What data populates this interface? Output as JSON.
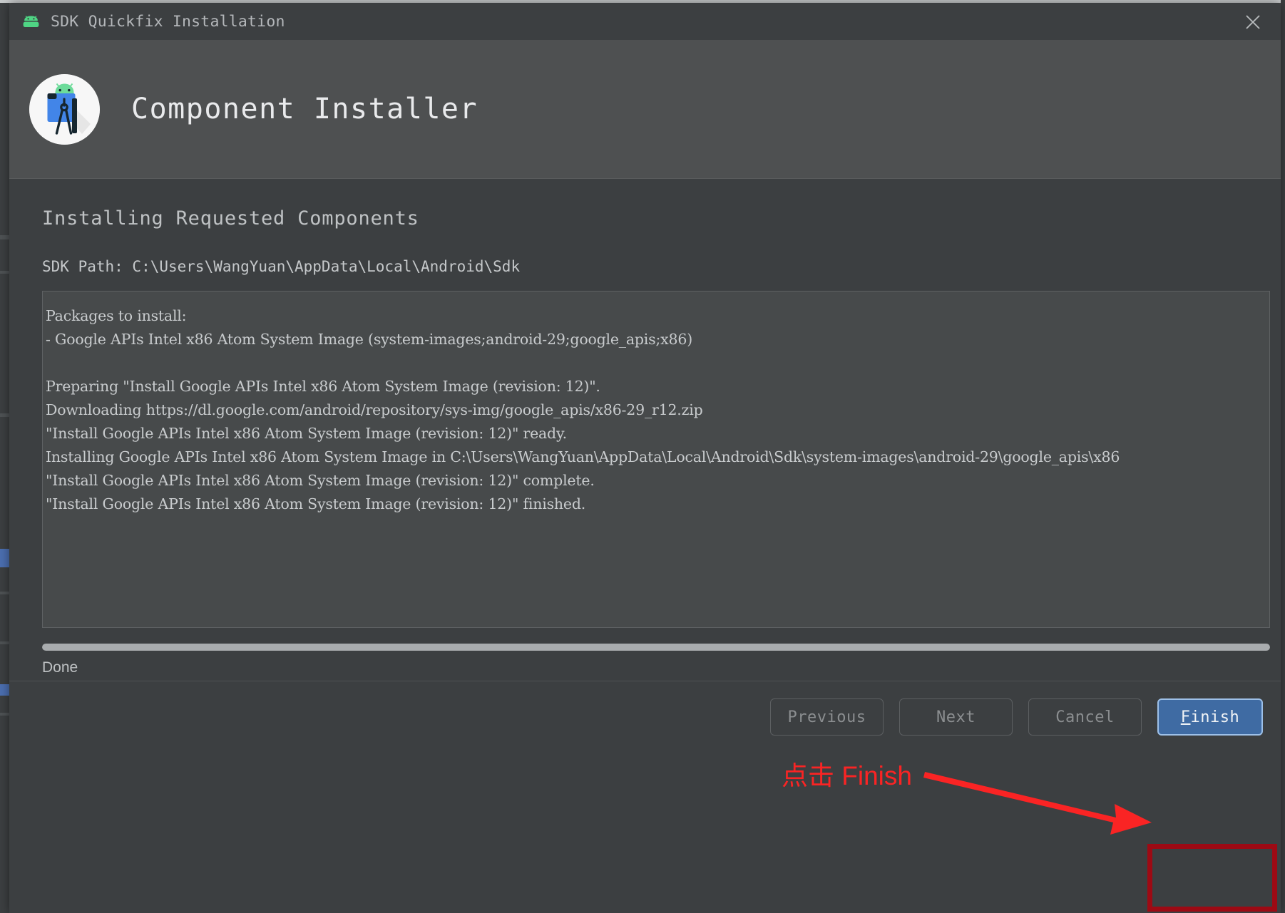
{
  "window": {
    "title": "SDK Quickfix Installation",
    "app_icon": "android-robot-icon",
    "close_icon": "close-icon"
  },
  "banner": {
    "title": "Component Installer",
    "logo_icon": "android-studio-logo-icon"
  },
  "main": {
    "step_title": "Installing Requested Components",
    "sdk_path_label": "SDK Path:  C:\\Users\\WangYuan\\AppData\\Local\\Android\\Sdk",
    "log_lines": [
      "Packages to install:",
      "- Google APIs Intel x86 Atom System Image (system-images;android-29;google_apis;x86)",
      "",
      "Preparing \"Install Google APIs Intel x86 Atom System Image (revision: 12)\".",
      "Downloading https://dl.google.com/android/repository/sys-img/google_apis/x86-29_r12.zip",
      "\"Install Google APIs Intel x86 Atom System Image (revision: 12)\" ready.",
      "Installing Google APIs Intel x86 Atom System Image in C:\\Users\\WangYuan\\AppData\\Local\\Android\\Sdk\\system-images\\android-29\\google_apis\\x86",
      "\"Install Google APIs Intel x86 Atom System Image (revision: 12)\" complete.",
      "\"Install Google APIs Intel x86 Atom System Image (revision: 12)\" finished."
    ],
    "progress_percent": 100,
    "status_text": "Done"
  },
  "footer": {
    "previous_label": "Previous",
    "next_label": "Next",
    "cancel_label": "Cancel",
    "finish_mnemonic": "F",
    "finish_rest": "inish"
  },
  "annotations": {
    "callout_text": "点击 Finish",
    "callout_color": "#fa2424",
    "highlight_color": "#9d0a14"
  },
  "colors": {
    "dialog_bg": "#3c3f41",
    "banner_bg": "#4e5051",
    "log_bg": "#474a4b",
    "primary_button": "#3f6ba3",
    "progress_fill": "#a9acae"
  }
}
